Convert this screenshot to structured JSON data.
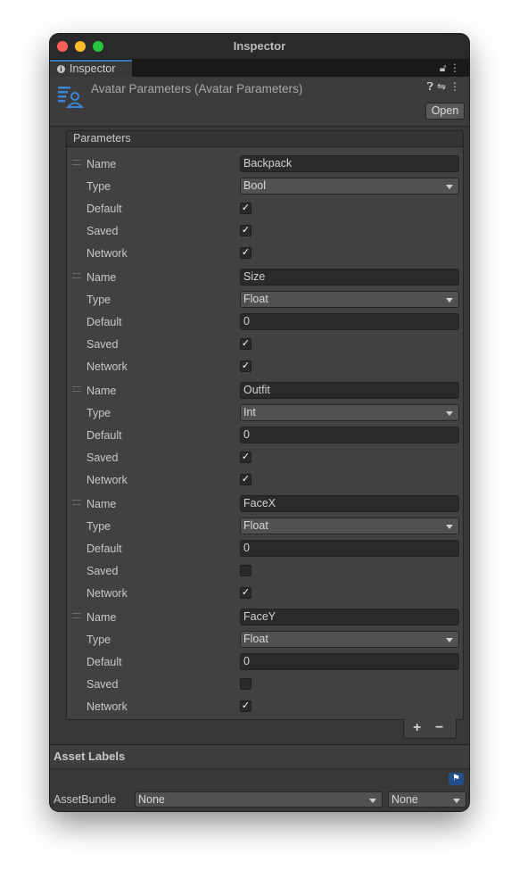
{
  "window": {
    "title": "Inspector"
  },
  "tab": {
    "label": "Inspector",
    "actions": [
      "lock-icon",
      "more-icon"
    ]
  },
  "component": {
    "title": "Avatar Parameters (Avatar Parameters)",
    "open_label": "Open",
    "header_icons": [
      "help-icon",
      "settings-icon",
      "more-icon"
    ]
  },
  "parameters": {
    "header": "Parameters",
    "labels": {
      "name": "Name",
      "type": "Type",
      "default": "Default",
      "saved": "Saved",
      "network": "Network"
    },
    "items": [
      {
        "name": "Backpack",
        "type": "Bool",
        "default": "checked",
        "saved": true,
        "network": true
      },
      {
        "name": "Size",
        "type": "Float",
        "default": "0",
        "saved": true,
        "network": true
      },
      {
        "name": "Outfit",
        "type": "Int",
        "default": "0",
        "saved": true,
        "network": true
      },
      {
        "name": "FaceX",
        "type": "Float",
        "default": "0",
        "saved": false,
        "network": true
      },
      {
        "name": "FaceY",
        "type": "Float",
        "default": "0",
        "saved": false,
        "network": true
      }
    ],
    "add_label": "+",
    "remove_label": "−"
  },
  "asset_labels": {
    "title": "Asset Labels",
    "assetbundle_label": "AssetBundle",
    "bundle_value": "None",
    "variant_value": "None"
  }
}
